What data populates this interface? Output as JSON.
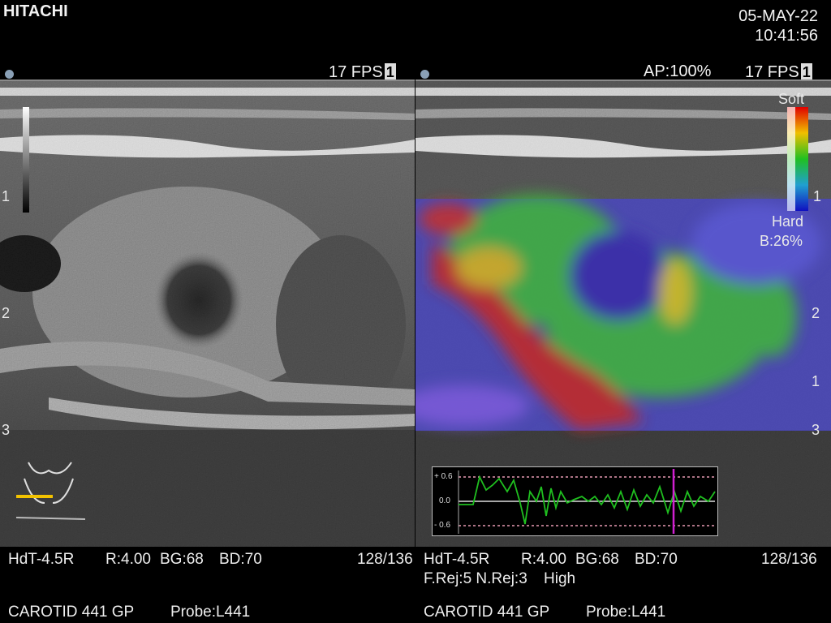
{
  "brand": "HITACHI",
  "date": "05-MAY-22",
  "time": "10:41:56",
  "left_panel": {
    "fps": "17 FPS",
    "frame_badge": "1",
    "depth_ticks": [
      "1",
      "2",
      "3"
    ],
    "transducer_settings": "HdT-4.5R",
    "r_value": "R:4.00",
    "bg_value": "BG:68",
    "bd_value": "BD:70",
    "line_count": "128/136",
    "preset": "CAROTID 441 GP",
    "probe": "Probe:L441"
  },
  "right_panel": {
    "ap": "AP:100%",
    "fps": "17 FPS",
    "frame_badge": "1",
    "colorbar_top": "Soft",
    "colorbar_bottom": "Hard",
    "colorbar_mark": "1",
    "b_ratio": "B:26%",
    "depth_ticks": [
      "1",
      "2",
      "1",
      "3"
    ],
    "transducer_settings": "HdT-4.5R",
    "r_value": "R:4.00",
    "bg_value": "BG:68",
    "bd_value": "BD:70",
    "line_count": "128/136",
    "rejection": "F.Rej:5 N.Rej:3",
    "quality": "High",
    "preset": "CAROTID 441 GP",
    "probe": "Probe:L441"
  },
  "strain_graph": {
    "y_labels": [
      "+ 0.6",
      "0.0",
      "- 0.6"
    ],
    "colors": {
      "trace": "#1fbf1f",
      "marker": "#d01fd0",
      "guides": "#e89ab2"
    }
  }
}
